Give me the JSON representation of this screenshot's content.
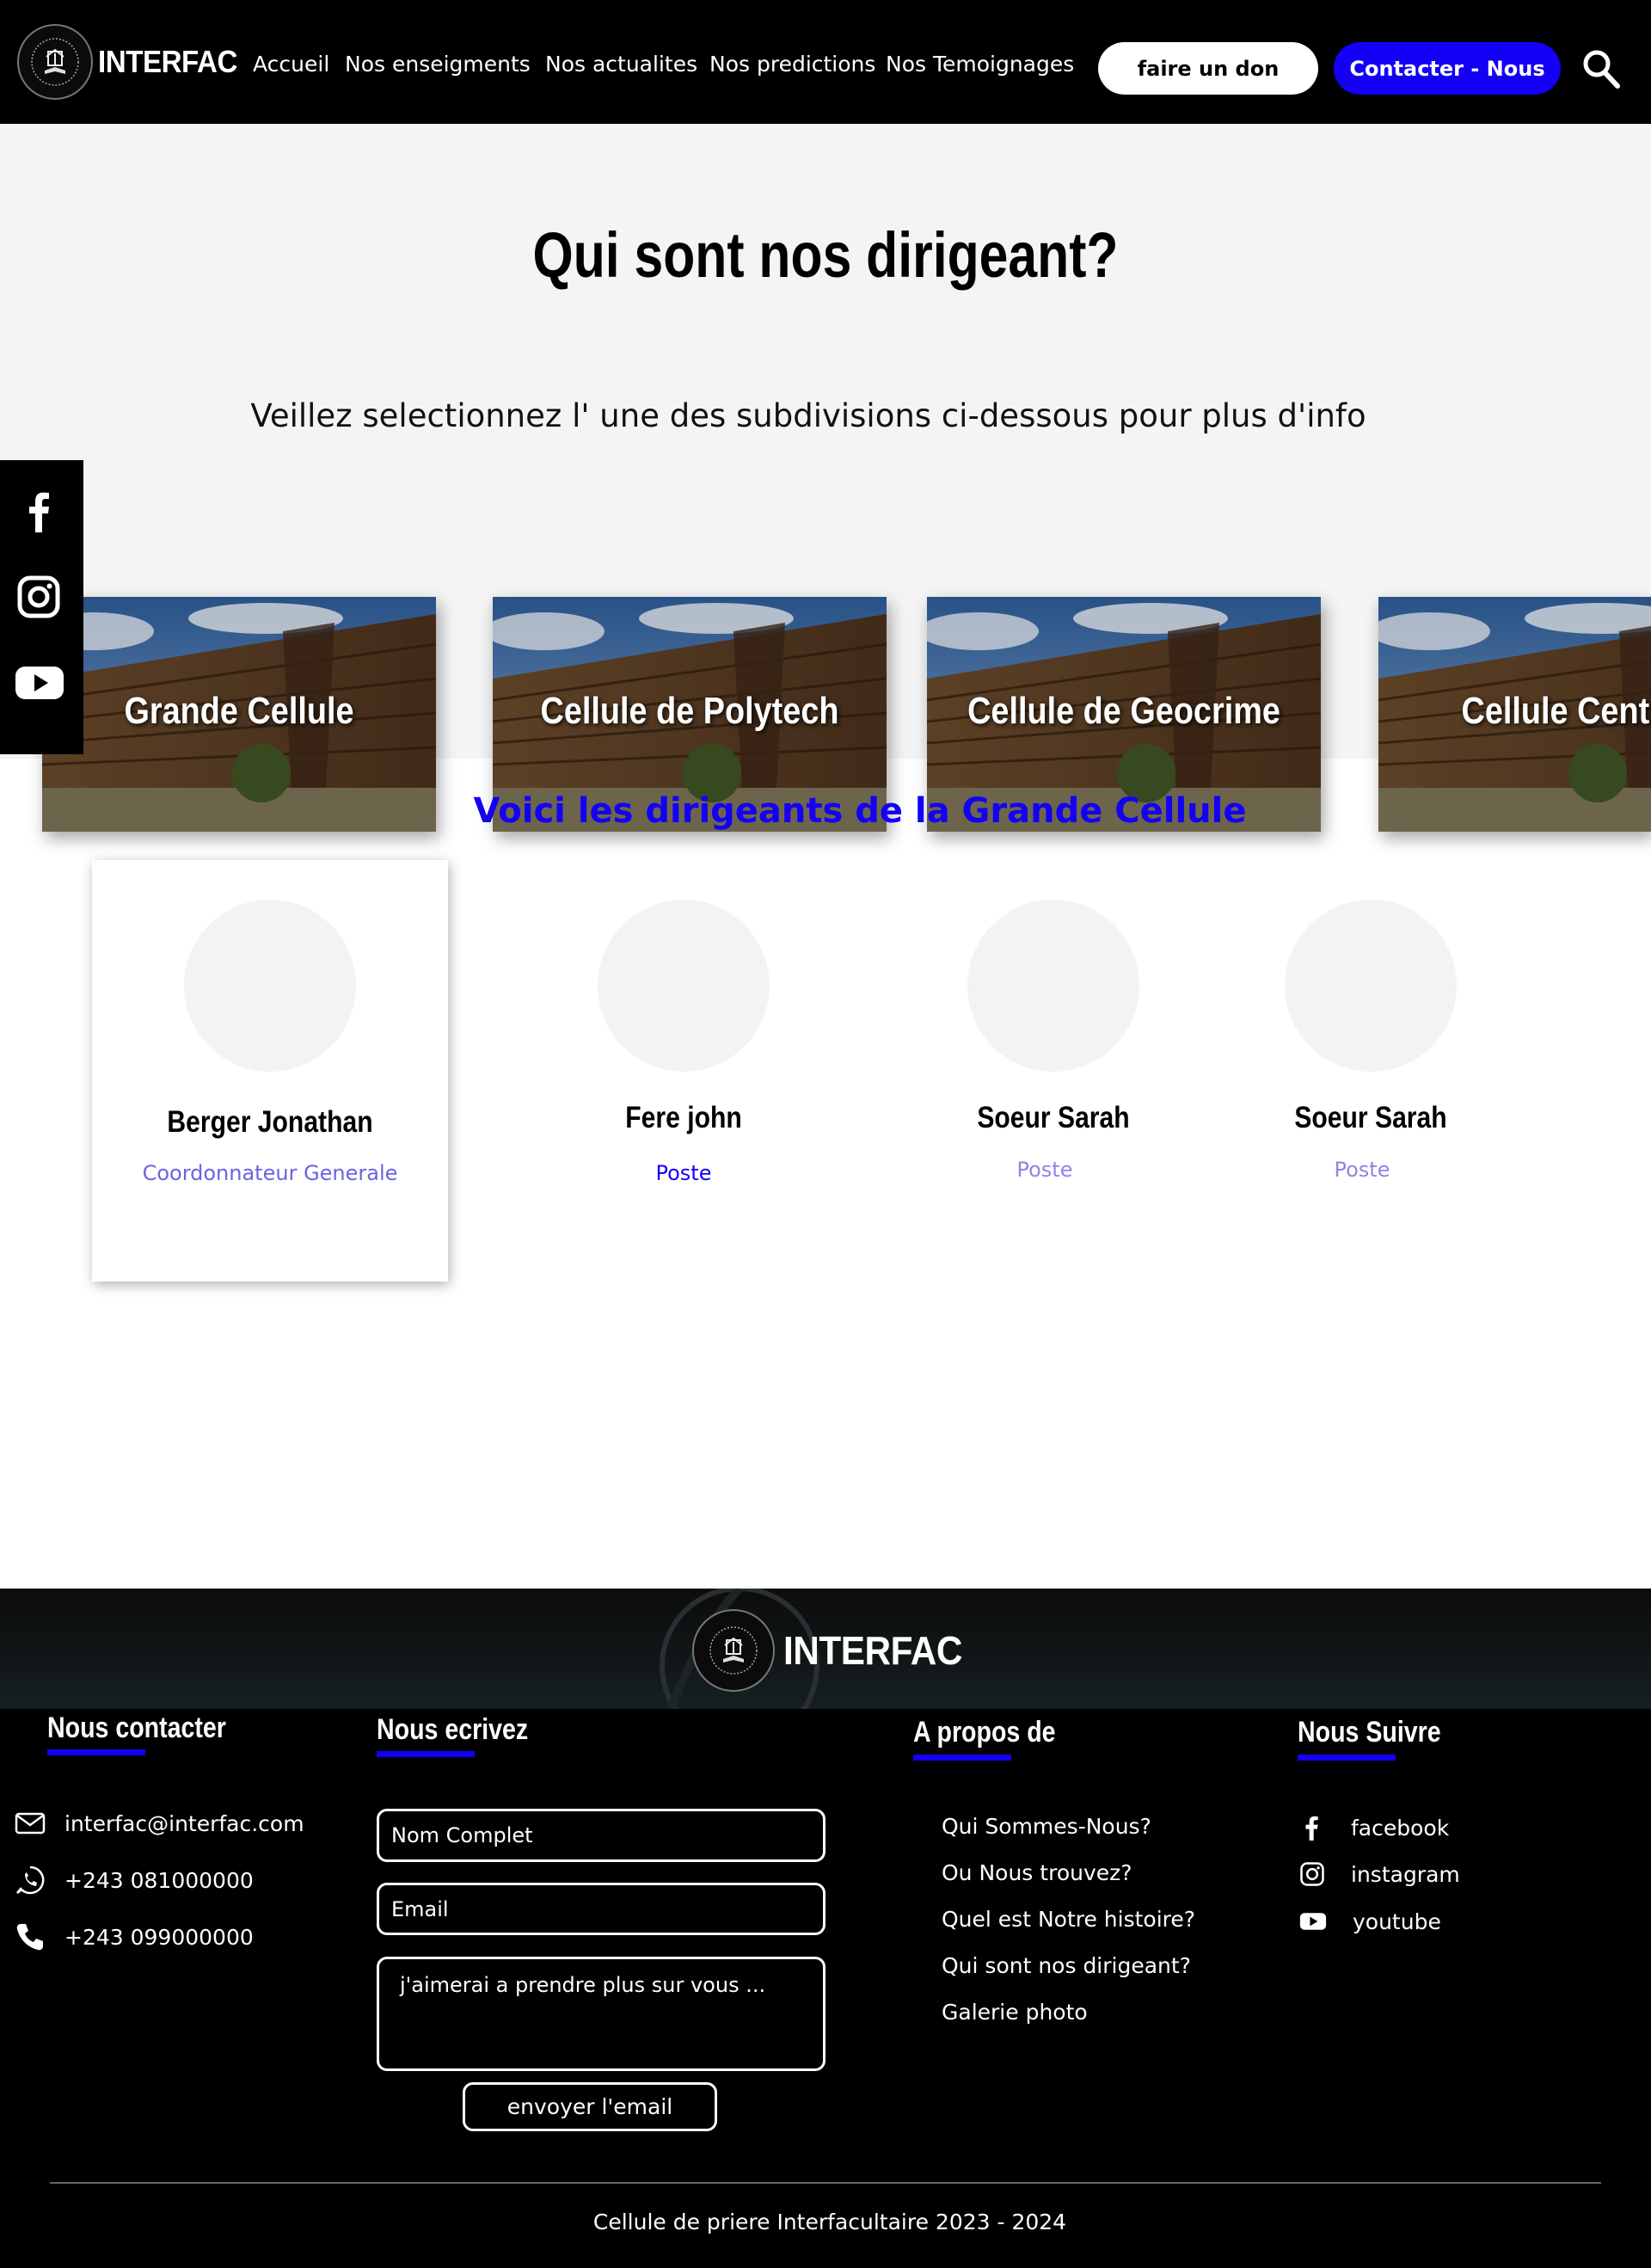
{
  "brand": {
    "name": "INTERFAC"
  },
  "nav": {
    "links": [
      "Accueil",
      "Nos enseigments",
      "Nos actualites",
      "Nos predictions",
      "Nos Temoignages"
    ],
    "donate_label": "faire un don",
    "contact_label": "Contacter - Nous",
    "accent_color": "#1300f5"
  },
  "hero": {
    "title": "Qui sont nos dirigeant?",
    "subtitle": "Veillez selectionnez l' une des subdivisions ci-dessous pour plus d'info",
    "cells": [
      "Grande Cellule",
      "Cellule de Polytech",
      "Cellule de Geocrime",
      "Cellule Central"
    ]
  },
  "social_bar": [
    "facebook-icon",
    "instagram-icon",
    "youtube-icon"
  ],
  "leaders": {
    "title": "Voici les dirigeants de la Grande Cellule",
    "items": [
      {
        "name": "Berger Jonathan",
        "role": "Coordonnateur Generale"
      },
      {
        "name": "Fere john",
        "role": "Poste"
      },
      {
        "name": "Soeur Sarah",
        "role": "Poste"
      },
      {
        "name": "Soeur Sarah",
        "role": "Poste"
      }
    ]
  },
  "footer": {
    "brand": "INTERFAC",
    "contact": {
      "heading": "Nous contacter",
      "email": "interfac@interfac.com",
      "whatsapp": "+243 081000000",
      "phone": "+243 099000000"
    },
    "form": {
      "heading": "Nous ecrivez",
      "name_placeholder": "Nom Complet",
      "email_placeholder": "Email",
      "message_placeholder": "j'aimerai a prendre plus sur vous ...",
      "send_label": "envoyer l'email"
    },
    "about": {
      "heading": "A propos de",
      "links": [
        "Qui Sommes-Nous?",
        "Ou Nous trouvez?",
        "Quel est Notre histoire?",
        "Qui sont nos dirigeant?",
        "Galerie photo"
      ]
    },
    "follow": {
      "heading": "Nous Suivre",
      "links": [
        "facebook",
        "instagram",
        "youtube"
      ]
    },
    "copyright": "Cellule de priere  Interfacultaire 2023 - 2024"
  }
}
